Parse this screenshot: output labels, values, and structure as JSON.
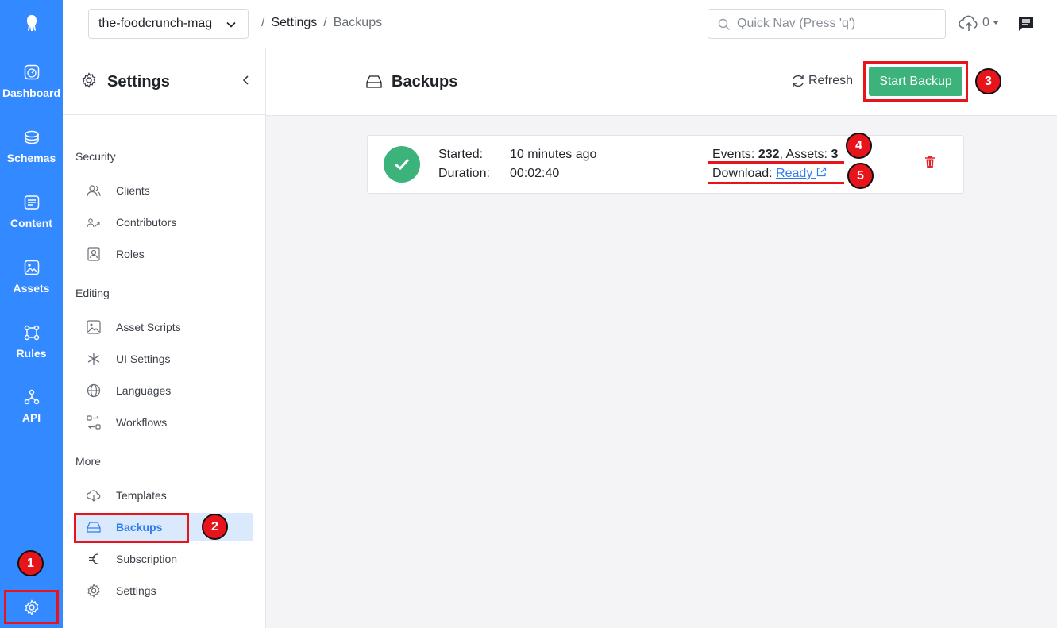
{
  "rail": {
    "items": [
      {
        "label": "Dashboard",
        "icon": "dashboard-icon"
      },
      {
        "label": "Schemas",
        "icon": "schemas-icon"
      },
      {
        "label": "Content",
        "icon": "content-icon"
      },
      {
        "label": "Assets",
        "icon": "assets-icon"
      },
      {
        "label": "Rules",
        "icon": "rules-icon"
      },
      {
        "label": "API",
        "icon": "api-icon"
      }
    ]
  },
  "topbar": {
    "app_name": "the-foodcrunch-mag",
    "breadcrumb": {
      "sep1": "/",
      "settings": "Settings",
      "sep2": "/",
      "current": "Backups"
    },
    "quicknav_placeholder": "Quick Nav (Press 'q')",
    "upload_count": "0"
  },
  "sidebar": {
    "title": "Settings",
    "groups": {
      "security": {
        "label": "Security",
        "items": [
          "Clients",
          "Contributors",
          "Roles"
        ]
      },
      "editing": {
        "label": "Editing",
        "items": [
          "Asset Scripts",
          "UI Settings",
          "Languages",
          "Workflows"
        ]
      },
      "more": {
        "label": "More",
        "items": [
          "Templates",
          "Backups",
          "Subscription",
          "Settings"
        ]
      }
    }
  },
  "main": {
    "title": "Backups",
    "refresh_label": "Refresh",
    "start_label": "Start Backup",
    "backup": {
      "started_label": "Started:",
      "started_value": "10 minutes ago",
      "duration_label": "Duration:",
      "duration_value": "00:02:40",
      "events_label": "Events:",
      "events_value": "232",
      "assets_label": "Assets:",
      "assets_value": "3",
      "download_label": "Download:",
      "download_link": "Ready"
    }
  },
  "badges": [
    "1",
    "2",
    "3",
    "4",
    "5"
  ],
  "colors": {
    "brand_blue": "#3389ff",
    "success": "#3bb37b",
    "danger": "#e8141c",
    "link": "#2f7bf0"
  }
}
